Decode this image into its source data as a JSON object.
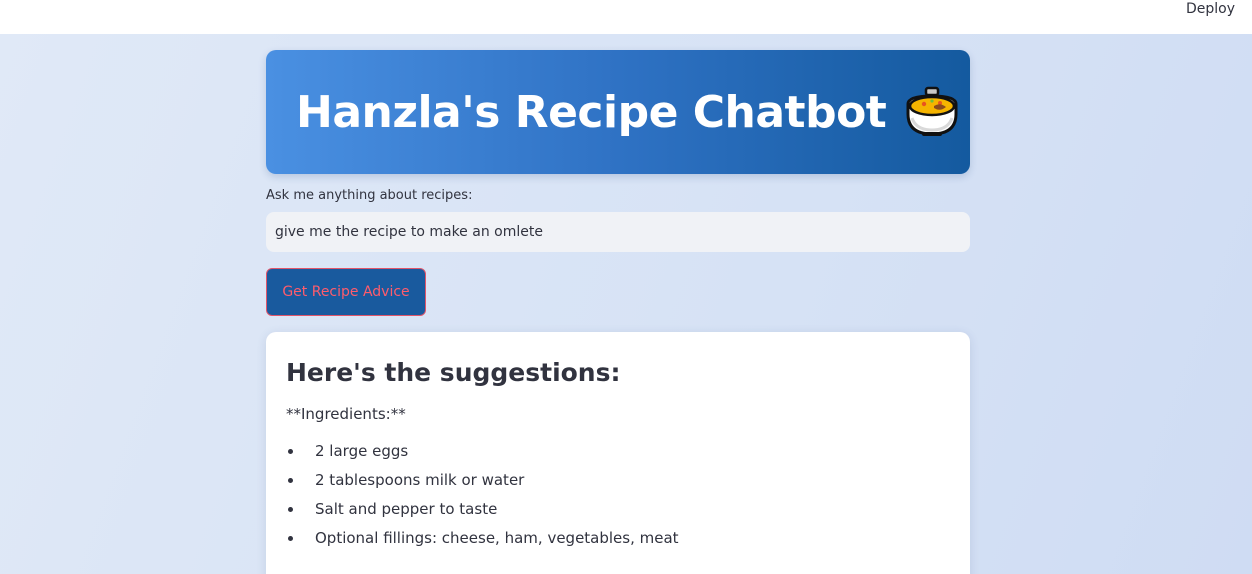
{
  "header": {
    "deploy_label": "Deploy"
  },
  "banner": {
    "title": "Hanzla's Recipe Chatbot",
    "icon": "stew-bowl-icon"
  },
  "query": {
    "label": "Ask me anything about recipes:",
    "value": "give me the recipe to make an omlete"
  },
  "actions": {
    "submit_label": "Get Recipe Advice"
  },
  "response": {
    "heading": "Here's the suggestions:",
    "intro": "**Ingredients:**",
    "items": [
      "2 large eggs",
      "2 tablespoons milk or water",
      "Salt and pepper to taste",
      "Optional fillings: cheese, ham, vegetables, meat"
    ]
  },
  "colors": {
    "banner_start": "#4a90e2",
    "banner_end": "#145a9f",
    "button_bg": "#195a9e",
    "button_text": "#ff5c6c"
  }
}
